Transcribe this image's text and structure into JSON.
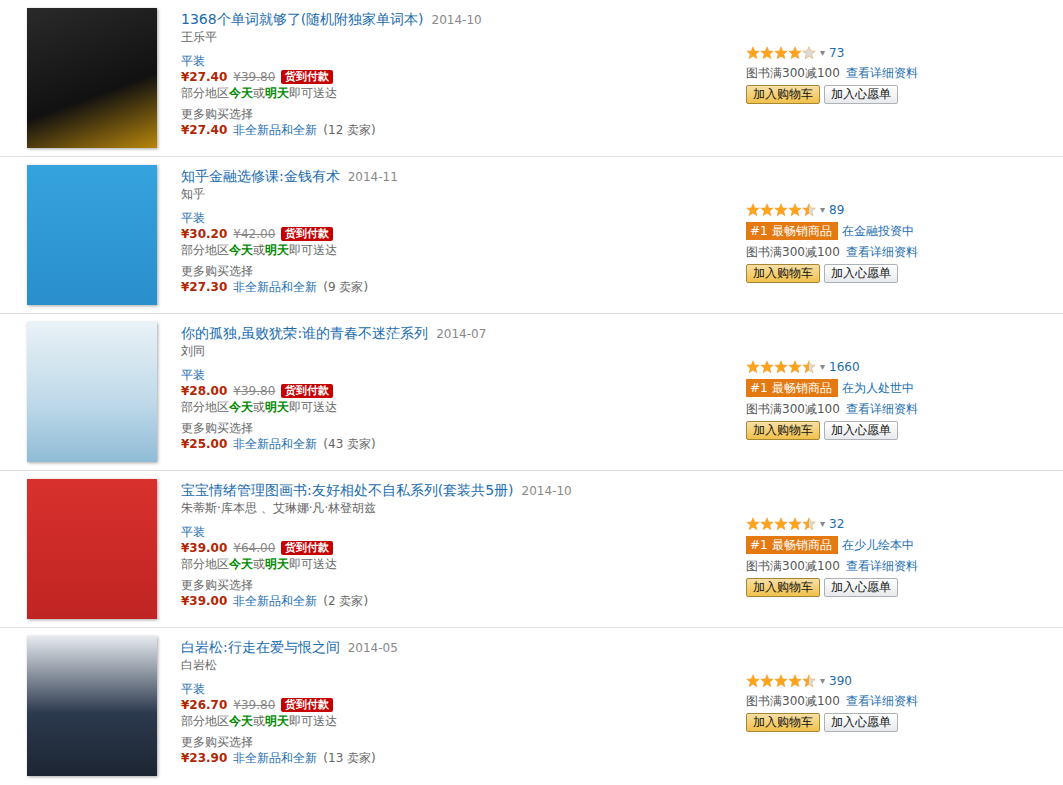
{
  "items": [
    {
      "title": "1368个单词就够了(随机附独家单词本)",
      "date": "2014-10",
      "author": "王乐平",
      "format": "平装",
      "price": "¥27.40",
      "list_price": "¥39.80",
      "badge": "货到付款",
      "delivery": [
        {
          "text": "部分地区",
          "highlight": false
        },
        {
          "text": "今天",
          "highlight": true
        },
        {
          "text": "或",
          "highlight": false
        },
        {
          "text": "明天",
          "highlight": true
        },
        {
          "text": "即可送达",
          "highlight": false
        }
      ],
      "more": "更多购买选择",
      "used_price": "¥27.40",
      "used_label": "非全新品和全新",
      "sellers": "(12 卖家)",
      "stars": 4,
      "caret": "▾",
      "reviews": "73",
      "promo": "图书满300减100",
      "details": "查看详细资料",
      "cart": "加入购物车",
      "wish": "加入心愿单"
    },
    {
      "title": "知乎金融选修课:金钱有术",
      "date": "2014-11",
      "author": "知乎",
      "format": "平装",
      "price": "¥30.20",
      "list_price": "¥42.00",
      "badge": "货到付款",
      "delivery": [
        {
          "text": "部分地区",
          "highlight": false
        },
        {
          "text": "今天",
          "highlight": true
        },
        {
          "text": "或",
          "highlight": false
        },
        {
          "text": "明天",
          "highlight": true
        },
        {
          "text": "即可送达",
          "highlight": false
        }
      ],
      "more": "更多购买选择",
      "used_price": "¥27.30",
      "used_label": "非全新品和全新",
      "sellers": "(9 卖家)",
      "stars": 4.5,
      "caret": "▾",
      "reviews": "89",
      "bestseller": {
        "rank": "#1 最畅销商品",
        "category": "在金融投资中"
      },
      "promo": "图书满300减100",
      "details": "查看详细资料",
      "cart": "加入购物车",
      "wish": "加入心愿单"
    },
    {
      "title": "你的孤独,虽败犹荣:谁的青春不迷茫系列",
      "date": "2014-07",
      "author": "刘同",
      "format": "平装",
      "price": "¥28.00",
      "list_price": "¥39.80",
      "badge": "货到付款",
      "delivery": [
        {
          "text": "部分地区",
          "highlight": false
        },
        {
          "text": "今天",
          "highlight": true
        },
        {
          "text": "或",
          "highlight": false
        },
        {
          "text": "明天",
          "highlight": true
        },
        {
          "text": "即可送达",
          "highlight": false
        }
      ],
      "more": "更多购买选择",
      "used_price": "¥25.00",
      "used_label": "非全新品和全新",
      "sellers": "(43 卖家)",
      "stars": 4.5,
      "caret": "▾",
      "reviews": "1660",
      "bestseller": {
        "rank": "#1 最畅销商品",
        "category": "在为人处世中"
      },
      "promo": "图书满300减100",
      "details": "查看详细资料",
      "cart": "加入购物车",
      "wish": "加入心愿单"
    },
    {
      "title": "宝宝情绪管理图画书:友好相处不自私系列(套装共5册)",
      "date": "2014-10",
      "author": "朱蒂斯·库本思 、艾琳娜·凡·林登胡兹",
      "format": "平装",
      "price": "¥39.00",
      "list_price": "¥64.00",
      "badge": "货到付款",
      "delivery": [
        {
          "text": "部分地区",
          "highlight": false
        },
        {
          "text": "今天",
          "highlight": true
        },
        {
          "text": "或",
          "highlight": false
        },
        {
          "text": "明天",
          "highlight": true
        },
        {
          "text": "即可送达",
          "highlight": false
        }
      ],
      "more": "更多购买选择",
      "used_price": "¥39.00",
      "used_label": "非全新品和全新",
      "sellers": "(2 卖家)",
      "stars": 4.5,
      "caret": "▾",
      "reviews": "32",
      "bestseller": {
        "rank": "#1 最畅销商品",
        "category": "在少儿绘本中"
      },
      "promo": "图书满300减100",
      "details": "查看详细资料",
      "cart": "加入购物车",
      "wish": "加入心愿单"
    },
    {
      "title": "白岩松:行走在爱与恨之间",
      "date": "2014-05",
      "author": "白岩松",
      "format": "平装",
      "price": "¥26.70",
      "list_price": "¥39.80",
      "badge": "货到付款",
      "delivery": [
        {
          "text": "部分地区",
          "highlight": false
        },
        {
          "text": "今天",
          "highlight": true
        },
        {
          "text": "或",
          "highlight": false
        },
        {
          "text": "明天",
          "highlight": true
        },
        {
          "text": "即可送达",
          "highlight": false
        }
      ],
      "more": "更多购买选择",
      "used_price": "¥23.90",
      "used_label": "非全新品和全新",
      "sellers": "(13 卖家)",
      "stars": 4.5,
      "caret": "▾",
      "reviews": "390",
      "promo": "图书满300减100",
      "details": "查看详细资料",
      "cart": "加入购物车",
      "wish": "加入心愿单"
    }
  ]
}
